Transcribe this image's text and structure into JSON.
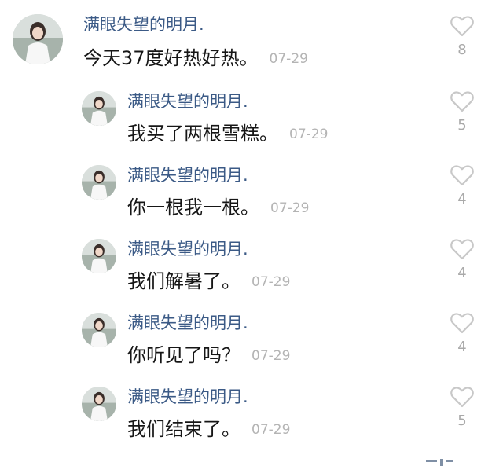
{
  "comments": [
    {
      "author": "满眼失望的明月.",
      "text": "今天37度好热好热。",
      "time": "07-29",
      "likes": "8"
    },
    {
      "author": "满眼失望的明月.",
      "text": "我买了两根雪糕。",
      "time": "07-29",
      "likes": "5"
    },
    {
      "author": "满眼失望的明月.",
      "text": "你一根我一根。",
      "time": "07-29",
      "likes": "4"
    },
    {
      "author": "满眼失望的明月.",
      "text": "我们解暑了。",
      "time": "07-29",
      "likes": "4"
    },
    {
      "author": "满眼失望的明月.",
      "text": "你听见了吗？",
      "time": "07-29",
      "likes": "4"
    },
    {
      "author": "满眼失望的明月.",
      "text": "我们结束了。",
      "time": "07-29",
      "likes": "5"
    }
  ],
  "icons": {
    "avatar": "avatar-photo",
    "like": "heart-outline-icon"
  },
  "colors": {
    "author": "#3b5a86",
    "text": "#161616",
    "muted": "#b4b4b4",
    "heart": "#c8c8c8"
  }
}
